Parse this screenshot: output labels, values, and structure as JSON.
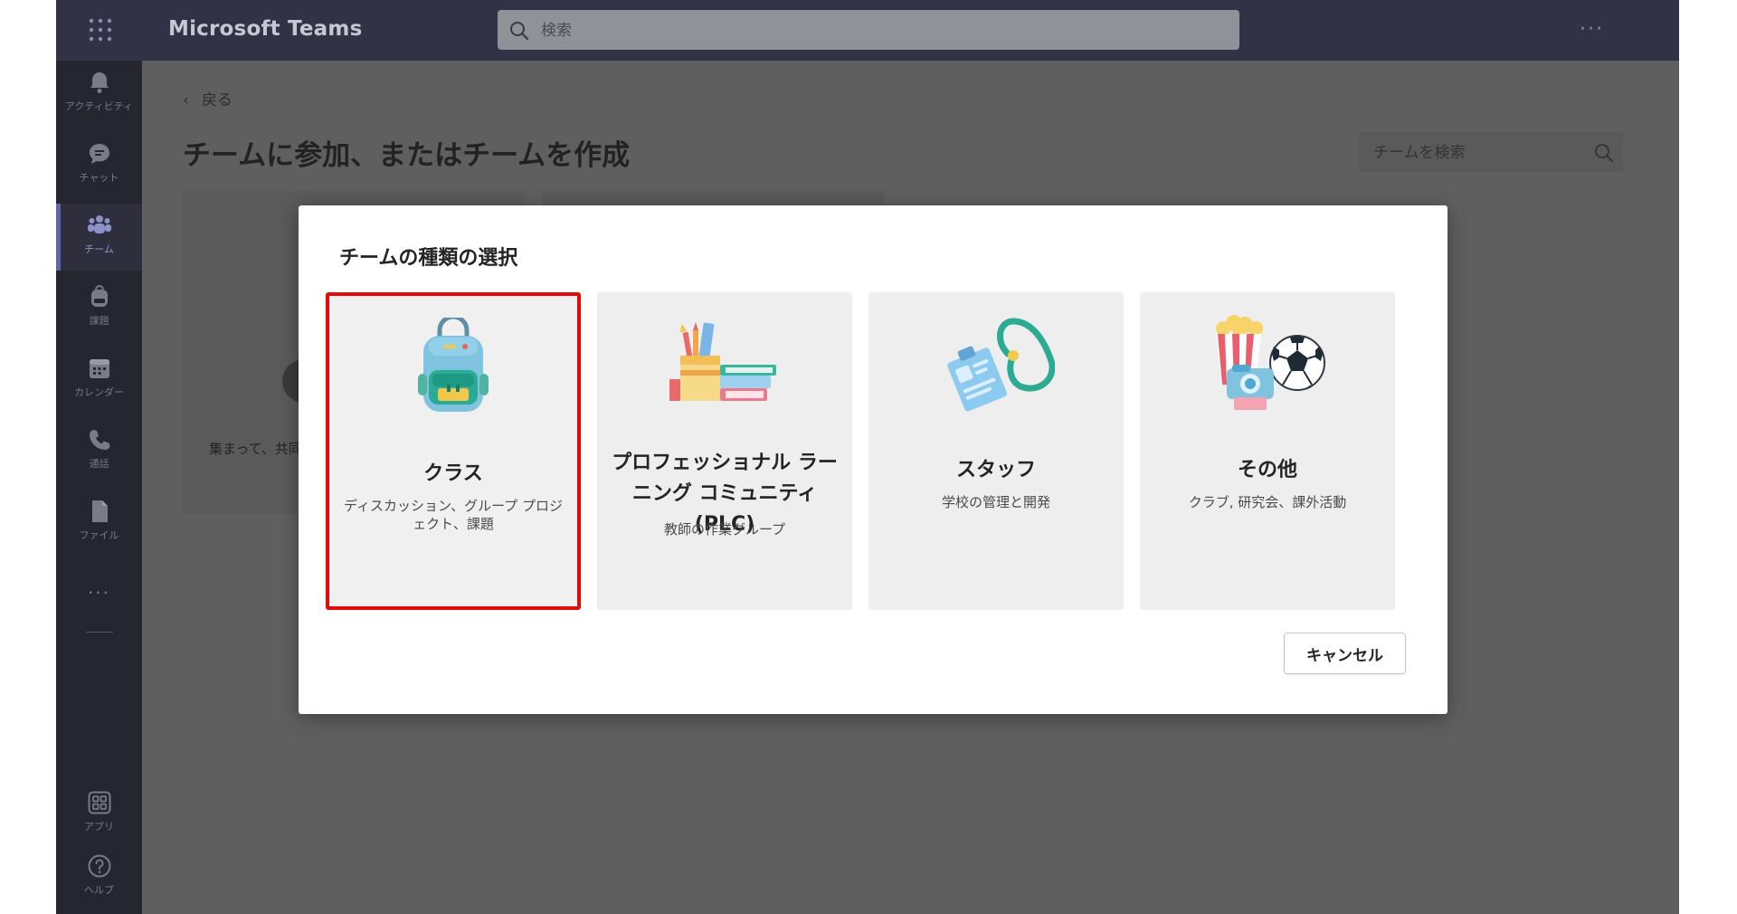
{
  "app": {
    "title": "Microsoft Teams",
    "search_placeholder": "検索",
    "more_label": "···"
  },
  "rail": {
    "items": [
      {
        "label": "アクティビティ",
        "icon": "bell-icon"
      },
      {
        "label": "チャット",
        "icon": "chat-icon"
      },
      {
        "label": "チーム",
        "icon": "teams-icon",
        "active": true
      },
      {
        "label": "課題",
        "icon": "backpack-icon"
      },
      {
        "label": "カレンダー",
        "icon": "calendar-icon"
      },
      {
        "label": "通話",
        "icon": "phone-icon"
      },
      {
        "label": "ファイル",
        "icon": "file-icon"
      },
      {
        "label": "アプリ",
        "icon": "apps-icon"
      },
      {
        "label": "ヘルプ",
        "icon": "help-icon"
      }
    ],
    "more_label": "···"
  },
  "page": {
    "back_label": "戻る",
    "title": "チームに参加、またはチームを作成",
    "team_search_placeholder": "チームを検索",
    "card_text": "集まって、共同"
  },
  "modal": {
    "title": "チームの種類の選択",
    "cards": [
      {
        "name": "クラス",
        "desc": "ディスカッション、グループ プロジェクト、課題",
        "illustration": "backpack-illustration",
        "selected": true
      },
      {
        "name": "プロフェッショナル ラーニング コミュニティ (PLC)",
        "desc": "教師の作業グループ",
        "illustration": "pencil-cup-books-illustration"
      },
      {
        "name": "スタッフ",
        "desc": "学校の管理と開発",
        "illustration": "id-badge-lanyard-illustration"
      },
      {
        "name": "その他",
        "desc": "クラブ, 研究会、課外活動",
        "illustration": "popcorn-camera-ball-illustration"
      }
    ],
    "cancel_label": "キャンセル"
  },
  "colors": {
    "accent": "#6264a7",
    "selection_border": "#e20b0b",
    "topbar": "#313245",
    "rail": "#262631"
  }
}
